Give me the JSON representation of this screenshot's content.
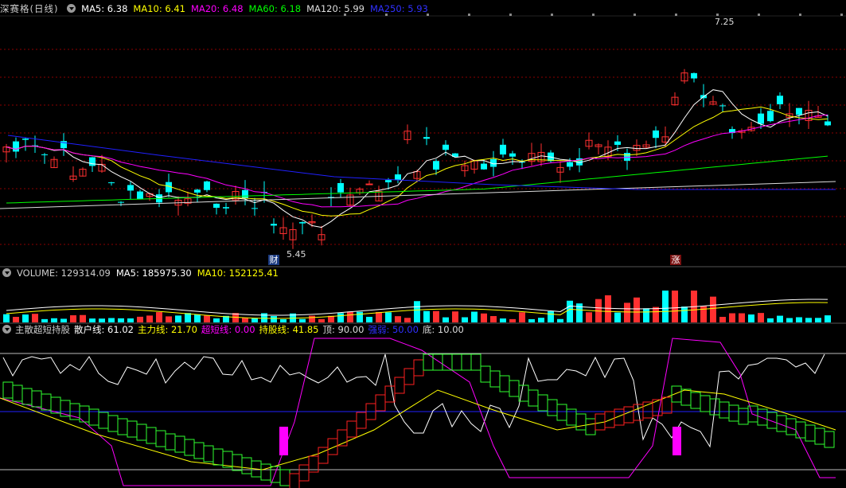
{
  "kline_header": {
    "stock_name": "深赛格(日线)",
    "items": [
      {
        "label": "MA5: 6.38",
        "color": "#ffffff"
      },
      {
        "label": "MA10: 6.41",
        "color": "#ffff00"
      },
      {
        "label": "MA20: 6.48",
        "color": "#ff00ff"
      },
      {
        "label": "MA60: 6.18",
        "color": "#00ff00"
      },
      {
        "label": "MA120: 5.99",
        "color": "#dddddd"
      },
      {
        "label": "MA250: 5.93",
        "color": "#3030ff"
      }
    ]
  },
  "kline_annotations": {
    "high_label": "7.25",
    "low_label": "5.45",
    "marker_cai": "财",
    "marker_zhang": "涨"
  },
  "volume_header": {
    "title": "VOLUME: 129314.09",
    "items": [
      {
        "label": "MA5: 185975.30",
        "color": "#ffffff"
      },
      {
        "label": "MA10: 152125.41",
        "color": "#ffff00"
      }
    ]
  },
  "indicator_header": {
    "title": "主散超短持股",
    "items": [
      {
        "label": "散户线: 61.02",
        "color": "#ffffff"
      },
      {
        "label": "主力线: 21.70",
        "color": "#ffff00"
      },
      {
        "label": "超短线: 0.00",
        "color": "#ff00ff"
      },
      {
        "label": "持股线: 41.85",
        "color": "#ffff00"
      },
      {
        "label": "顶: 90.00",
        "color": "#dddddd"
      },
      {
        "label": "强弱: 50.00",
        "color": "#3030ff"
      },
      {
        "label": "底: 10.00",
        "color": "#dddddd"
      }
    ]
  },
  "colors": {
    "up": "#ff3030",
    "down": "#00ffff",
    "ma5": "#ffffff",
    "ma10": "#ffff00",
    "ma20": "#ff00ff",
    "ma60": "#00ff00",
    "ma120": "#dddddd",
    "ma250": "#2020ff",
    "grid": "#8b0000",
    "separator": "#555555",
    "ind_up": "#ff2020",
    "ind_down": "#30ff30",
    "ind_burst": "#ff00ff"
  }
}
